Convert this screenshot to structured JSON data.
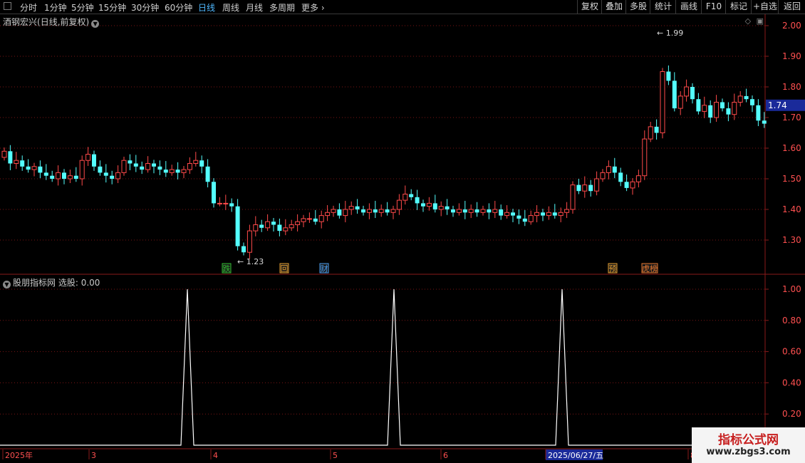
{
  "toolbar": {
    "timeframes": [
      {
        "label": "分时",
        "active": false
      },
      {
        "label": "1分钟",
        "active": false
      },
      {
        "label": "5分钟",
        "active": false
      },
      {
        "label": "15分钟",
        "active": false
      },
      {
        "label": "30分钟",
        "active": false
      },
      {
        "label": "60分钟",
        "active": false
      },
      {
        "label": "日线",
        "active": true
      },
      {
        "label": "周线",
        "active": false
      },
      {
        "label": "月线",
        "active": false
      },
      {
        "label": "多周期",
        "active": false
      },
      {
        "label": "更多",
        "active": false
      }
    ],
    "more_icon": "chevron-right-icon",
    "right_buttons": [
      "复权",
      "叠加",
      "多股",
      "统计",
      "画线",
      "F10",
      "标记",
      "+自选",
      "返回"
    ]
  },
  "main_panel": {
    "stock_name": "酒钢宏兴",
    "period_info": "(日线,前复权)",
    "price_axis": [
      "2.00",
      "1.90",
      "1.80",
      "1.70",
      "1.60",
      "1.50",
      "1.40",
      "1.30"
    ],
    "current_price": "1.74",
    "high_label": "1.99",
    "low_label": "1.23",
    "event_markers": [
      {
        "label": "跌",
        "color": "#2fbf2f"
      },
      {
        "label": "回",
        "color": "#e8a030"
      },
      {
        "label": "财",
        "color": "#4a9ef0"
      },
      {
        "label": "预",
        "color": "#e8a030"
      },
      {
        "label": "龙虎榜",
        "color": "#e87830"
      }
    ]
  },
  "indicator_panel": {
    "name": "股朋指标网",
    "select_label": "选股",
    "select_value": "0.00",
    "axis": [
      "1.00",
      "0.80",
      "0.60",
      "0.40",
      "0.20"
    ],
    "signals": [
      1,
      1,
      1
    ]
  },
  "date_axis": {
    "labels": [
      "2025年",
      "3",
      "4",
      "5",
      "6",
      "2025/06/27/五",
      "8"
    ]
  },
  "watermark": {
    "line1": "指标公式网",
    "line2": "www.zbgs3.com"
  },
  "colors": {
    "up": "#ff4a4a",
    "down": "#54ffff",
    "grid": "#7a1515",
    "axis_text": "#ff5050",
    "active_tab": "#4fb8ff"
  }
}
